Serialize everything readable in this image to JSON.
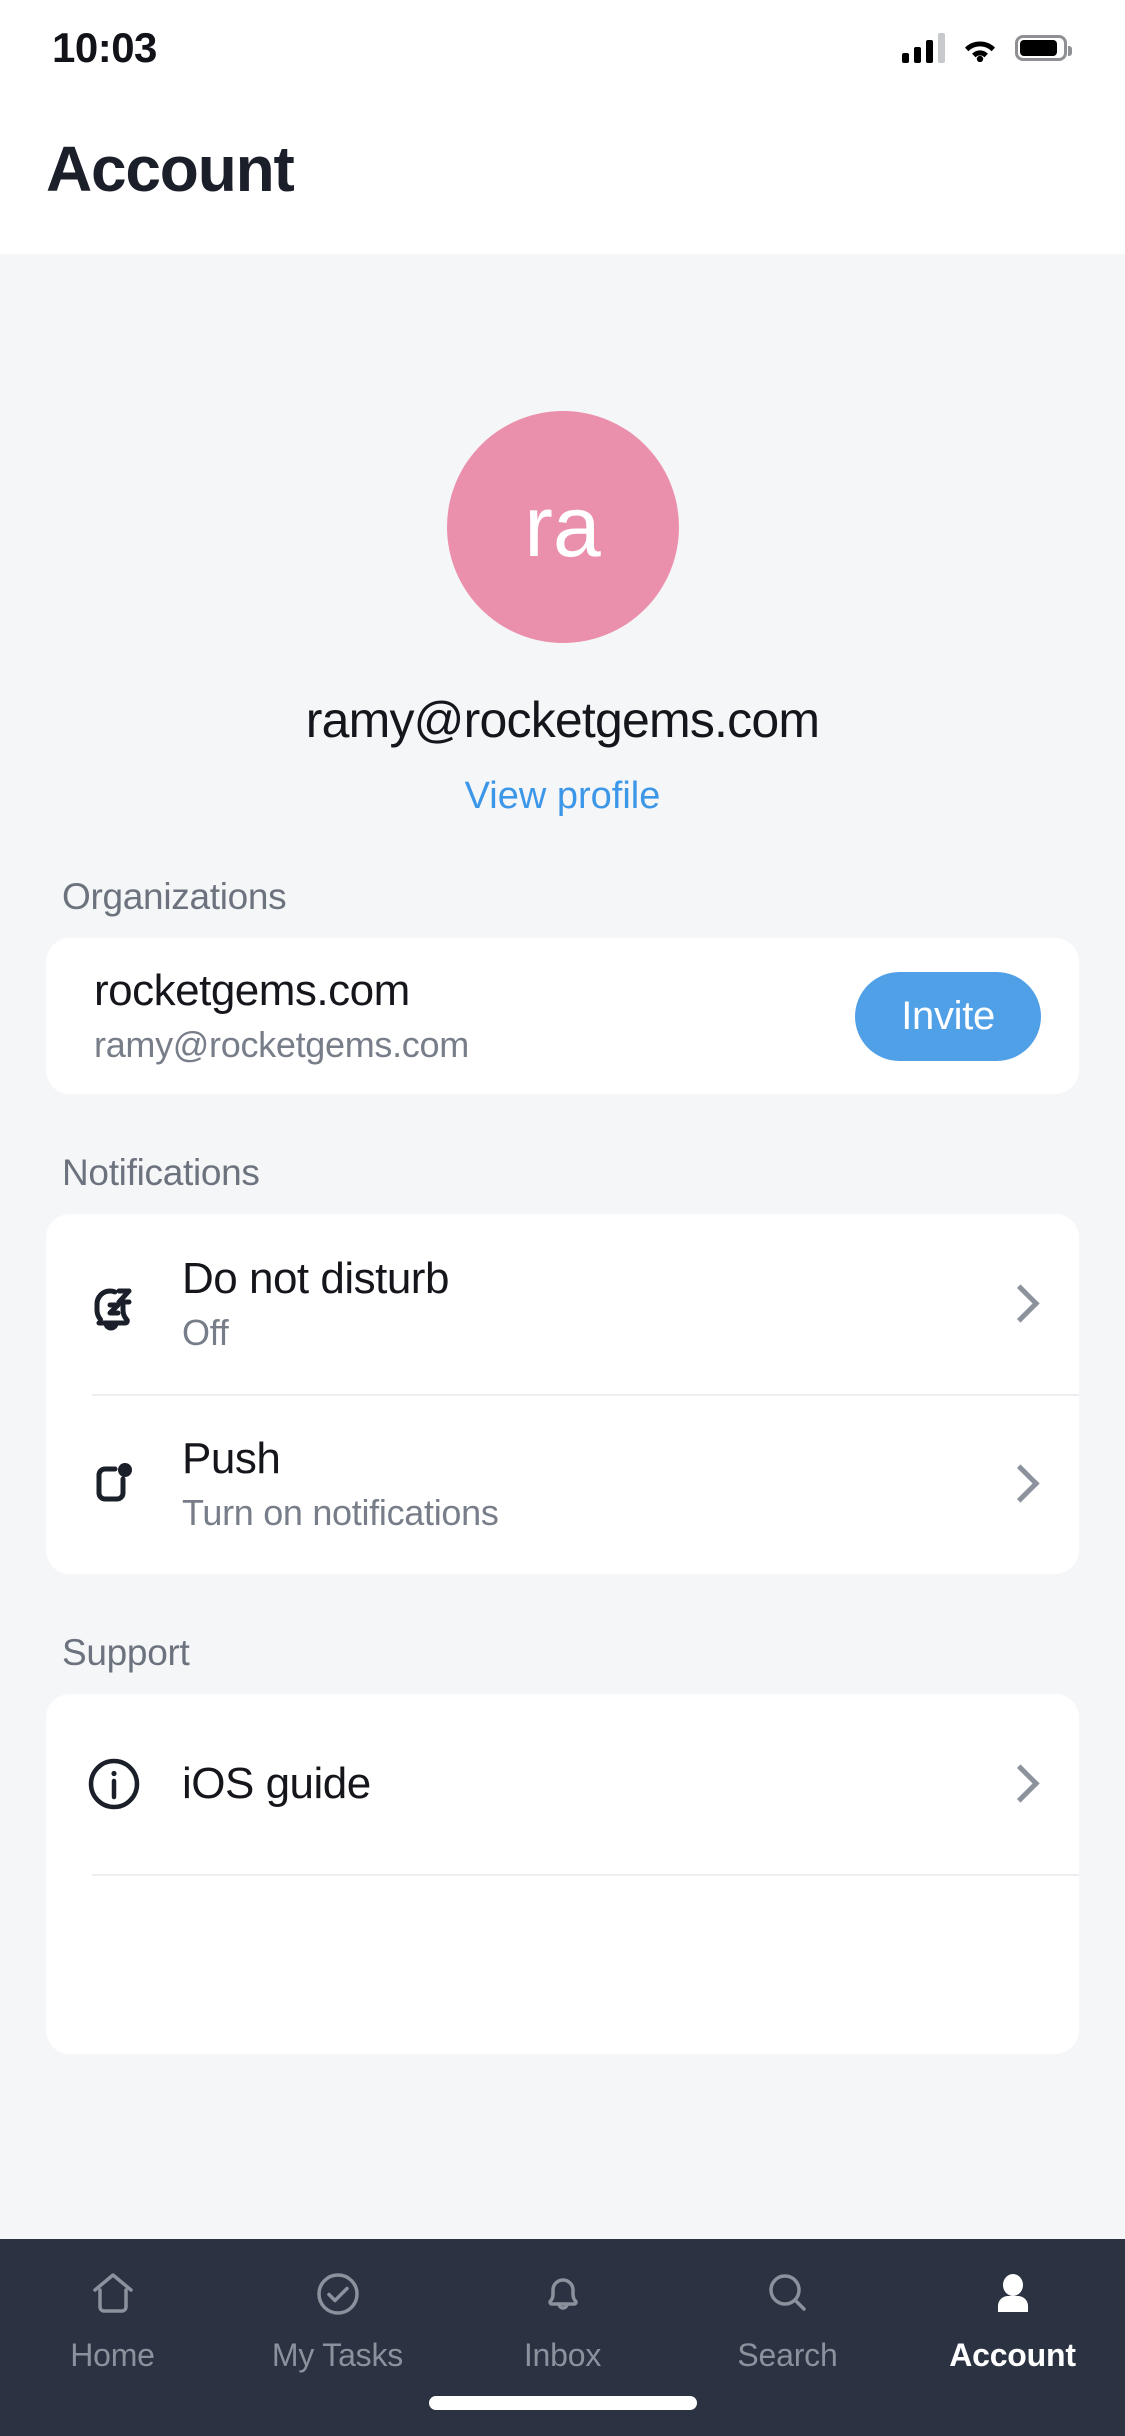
{
  "status_bar": {
    "time": "10:03",
    "cellular_icon": "signal-bars-icon",
    "wifi_icon": "wifi-icon",
    "battery_icon": "battery-icon"
  },
  "header": {
    "title": "Account"
  },
  "profile": {
    "avatar_initials": "ra",
    "avatar_color": "#eb90ac",
    "email": "ramy@rocketgems.com",
    "view_profile_label": "View profile",
    "link_color": "#3d97e8"
  },
  "sections": [
    {
      "title": "Organizations",
      "rows": [
        {
          "name": "rocketgems.com",
          "sub": "ramy@rocketgems.com",
          "action_label": "Invite",
          "action_color": "#50a0e8"
        }
      ]
    },
    {
      "title": "Notifications",
      "rows": [
        {
          "icon": "do-not-disturb-icon",
          "title": "Do not disturb",
          "sub": "Off"
        },
        {
          "icon": "push-notification-icon",
          "title": "Push",
          "sub": "Turn on notifications"
        }
      ]
    },
    {
      "title": "Support",
      "rows": [
        {
          "icon": "info-circle-icon",
          "title": "iOS guide",
          "sub": ""
        }
      ]
    }
  ],
  "tabbar": {
    "background": "#2b3241",
    "active_index": 4,
    "tabs": [
      {
        "label": "Home",
        "icon": "home-icon"
      },
      {
        "label": "My Tasks",
        "icon": "check-circle-icon"
      },
      {
        "label": "Inbox",
        "icon": "bell-icon"
      },
      {
        "label": "Search",
        "icon": "search-icon"
      },
      {
        "label": "Account",
        "icon": "person-icon"
      }
    ]
  }
}
